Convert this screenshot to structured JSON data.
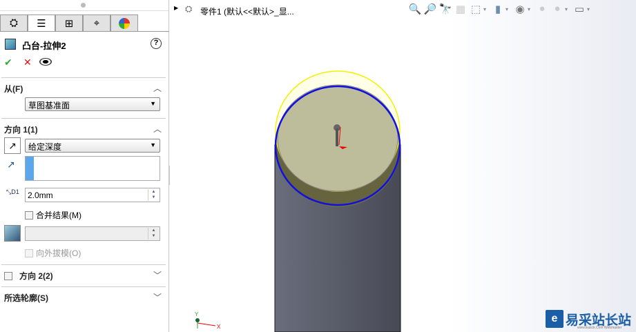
{
  "panel": {
    "tabs": [
      {
        "icon": "feature-manager-icon"
      },
      {
        "icon": "property-manager-icon"
      },
      {
        "icon": "configuration-manager-icon"
      },
      {
        "icon": "dimxpert-icon"
      },
      {
        "icon": "display-manager-icon"
      }
    ],
    "feature_title": "凸台-拉伸2",
    "help": "?",
    "ok": "✔",
    "cancel": "✕",
    "from": {
      "label": "从(F)",
      "value": "草图基准面"
    },
    "direction1": {
      "label": "方向 1(1)",
      "end_condition": "给定深度",
      "depth": "2.0mm",
      "merge_label": "合并结果(M)",
      "draft_label": "向外拔模(O)"
    },
    "direction2": {
      "label": "方向 2(2)"
    },
    "contours": {
      "label": "所选轮廓(S)"
    }
  },
  "viewport": {
    "tree_label": "零件1  (默认<<默认>_显...",
    "watermark": "易采站长站",
    "watermark_sub": "www.Easck.Com Webmaster",
    "triad": {
      "x": "X",
      "y": "Y"
    }
  },
  "colors": {
    "highlight": "#ffff00",
    "selection": "#0000ff",
    "face": "#bdbd9c",
    "body": "#4e5260"
  }
}
